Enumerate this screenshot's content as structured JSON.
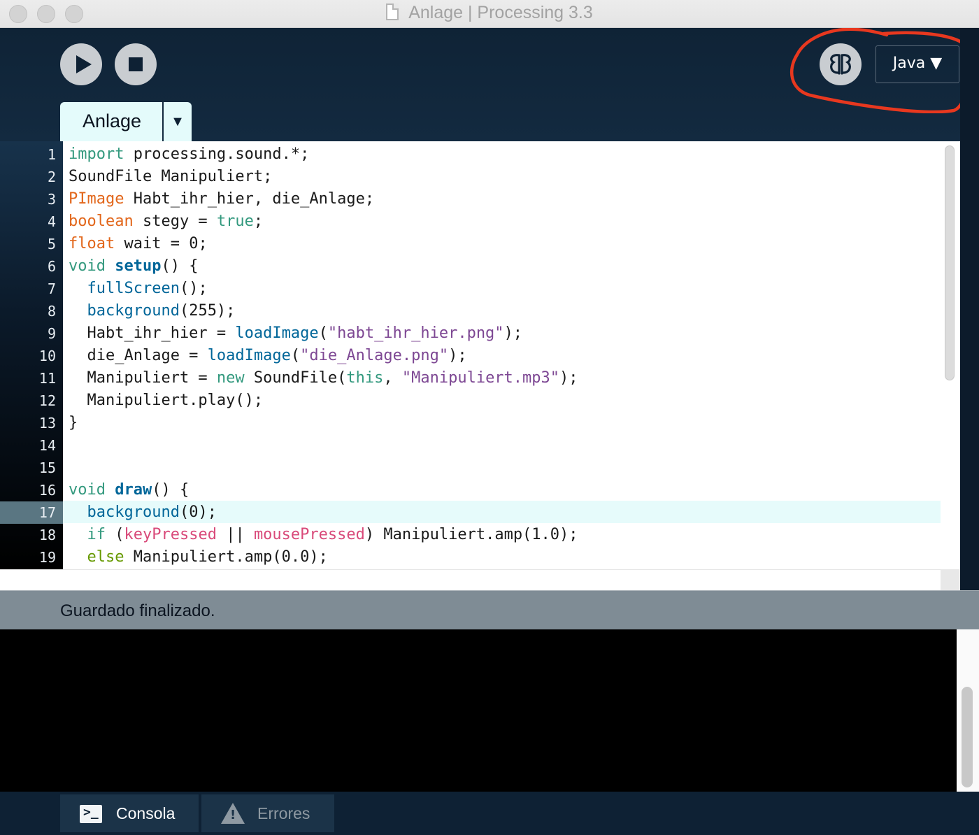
{
  "window": {
    "title": "Anlage | Processing 3.3"
  },
  "toolbar": {
    "run_label": "Run",
    "stop_label": "Stop",
    "mode_label": "Java ▼",
    "debug_icon": "butterfly-icon"
  },
  "tabs": {
    "active": "Anlage",
    "menu_arrow": "▼"
  },
  "editor": {
    "line_numbers": [
      "1",
      "2",
      "3",
      "4",
      "5",
      "6",
      "7",
      "8",
      "9",
      "10",
      "11",
      "12",
      "13",
      "14",
      "15",
      "16",
      "17",
      "18",
      "19"
    ],
    "current_line": 17,
    "lines": [
      "import processing.sound.*;",
      "SoundFile Manipuliert;",
      "PImage Habt_ihr_hier, die_Anlage;",
      "boolean stegy = true;",
      "float wait = 0;",
      "void setup() {",
      "  fullScreen();",
      "  background(255);",
      "  Habt_ihr_hier = loadImage(\"habt_ihr_hier.png\");",
      "  die_Anlage = loadImage(\"die_Anlage.png\");",
      "  Manipuliert = new SoundFile(this, \"Manipuliert.mp3\");",
      "  Manipuliert.play();",
      "}",
      "",
      "",
      "void draw() {",
      "  background(0);",
      "  if (keyPressed || mousePressed) Manipuliert.amp(1.0);",
      "  else Manipuliert.amp(0.0);"
    ]
  },
  "status": {
    "message": "Guardado finalizado."
  },
  "bottom_tabs": {
    "console": "Consola",
    "errors": "Errores"
  },
  "colors": {
    "toolbar_bg": "#0f2336",
    "keyword": "#33997e",
    "type": "#e2661a",
    "function": "#006699",
    "string": "#7d4793",
    "annotation": "#e8381f"
  }
}
